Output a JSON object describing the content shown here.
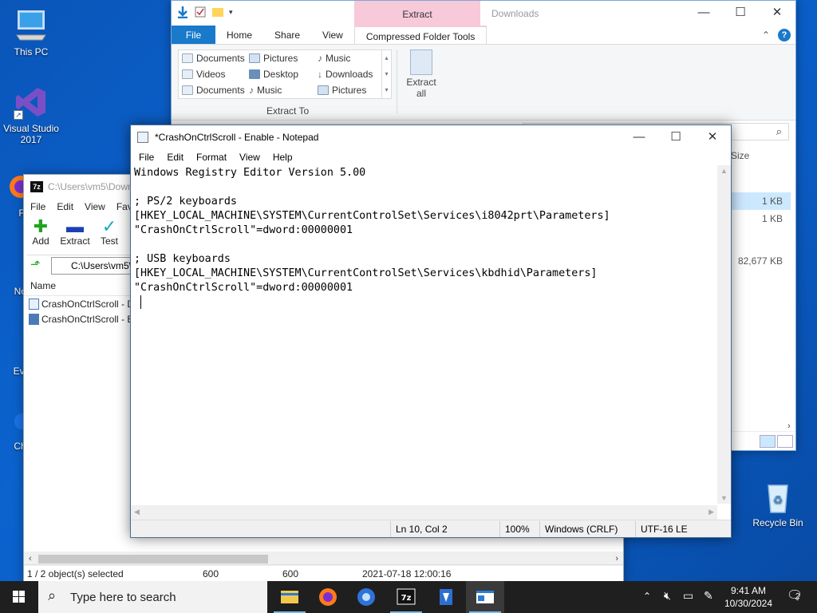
{
  "desktop": {
    "icons": [
      {
        "label": "This PC"
      },
      {
        "label": "Visual Studio 2017"
      },
      {
        "label": "F"
      },
      {
        "label": "Not"
      },
      {
        "label": "Eve"
      },
      {
        "label": "Chr"
      },
      {
        "label": "Recycle Bin"
      }
    ]
  },
  "explorer": {
    "context_tab": "Extract",
    "title": "Downloads",
    "tabs": [
      "File",
      "Home",
      "Share",
      "View",
      "Compressed Folder Tools"
    ],
    "ribbon": {
      "col1": [
        "Documents",
        "Videos",
        "Documents"
      ],
      "col2": [
        "Pictures",
        "Desktop",
        "Music"
      ],
      "col3": [
        "Music",
        "Downloads",
        "Pictures"
      ],
      "group_label": "Extract To",
      "extract_all": "Extract all"
    },
    "column_size": "Size",
    "sizes": [
      "1 KB",
      "1 KB",
      "82,677 KB"
    ]
  },
  "sevenzip": {
    "title": "C:\\Users\\vm5\\Downloads\\",
    "app_icon": "7z",
    "menu": [
      "File",
      "Edit",
      "View",
      "Favorites"
    ],
    "toolbar": [
      "Add",
      "Extract",
      "Test"
    ],
    "path": "C:\\Users\\vm5\\Downloads\\",
    "column_name": "Name",
    "files": [
      "CrashOnCtrlScroll - Disable.reg",
      "CrashOnCtrlScroll - Enable.reg"
    ],
    "status": {
      "selected": "1 / 2 object(s) selected",
      "size1": "600",
      "size2": "600",
      "modified": "2021-07-18 12:00:16"
    }
  },
  "notepad": {
    "title": "*CrashOnCtrlScroll - Enable - Notepad",
    "menu": [
      "File",
      "Edit",
      "Format",
      "View",
      "Help"
    ],
    "lines": [
      "Windows Registry Editor Version 5.00",
      "",
      "; PS/2 keyboards",
      "[HKEY_LOCAL_MACHINE\\SYSTEM\\CurrentControlSet\\Services\\i8042prt\\Parameters]",
      "\"CrashOnCtrlScroll\"=dword:00000001",
      "",
      "; USB keyboards",
      "[HKEY_LOCAL_MACHINE\\SYSTEM\\CurrentControlSet\\Services\\kbdhid\\Parameters]",
      "\"CrashOnCtrlScroll\"=dword:00000001"
    ],
    "status": {
      "position": "Ln 10, Col 2",
      "zoom": "100%",
      "line_ending": "Windows (CRLF)",
      "encoding": "UTF-16 LE"
    }
  },
  "taskbar": {
    "search_placeholder": "Type here to search",
    "apps": [
      "file-explorer-icon",
      "firefox-icon",
      "chrome-icon",
      "7zip-icon",
      "visual-studio-icon",
      "notepad-icon"
    ],
    "time": "9:41 AM",
    "date": "10/30/2024",
    "notification_count": "2"
  },
  "colors": {
    "desktop": "#0a5cc4",
    "file_tab": "#1979ca",
    "extract_context": "#f7c9d9",
    "taskbar": "#1f1f1f",
    "taskbar_active": "#76b9ed"
  }
}
